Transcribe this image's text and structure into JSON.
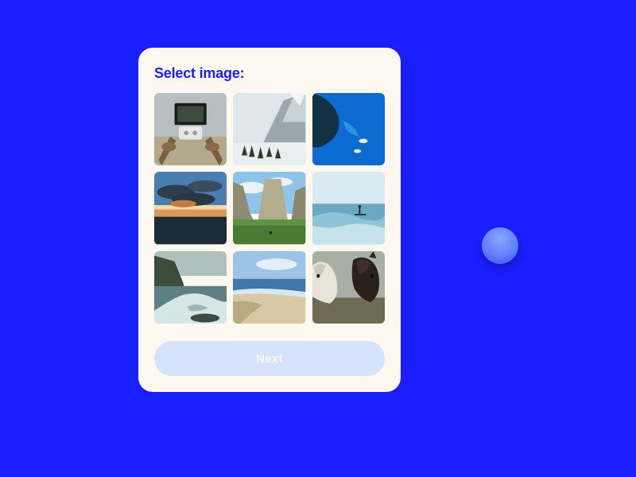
{
  "colors": {
    "background": "#1a1fff",
    "card": "#fdf9f1",
    "accent": "#1a1fff",
    "button_bg": "#d7e2fb",
    "button_text": "#f8f7f2"
  },
  "card": {
    "title": "Select image:",
    "next_label": "Next",
    "thumbs": [
      {
        "name": "drone-pov"
      },
      {
        "name": "snow-mountain"
      },
      {
        "name": "blue-bay"
      },
      {
        "name": "sunset-clouds"
      },
      {
        "name": "valley-cliffs"
      },
      {
        "name": "surfer-wave"
      },
      {
        "name": "rocky-shore"
      },
      {
        "name": "sandy-beach"
      },
      {
        "name": "horses"
      }
    ]
  }
}
